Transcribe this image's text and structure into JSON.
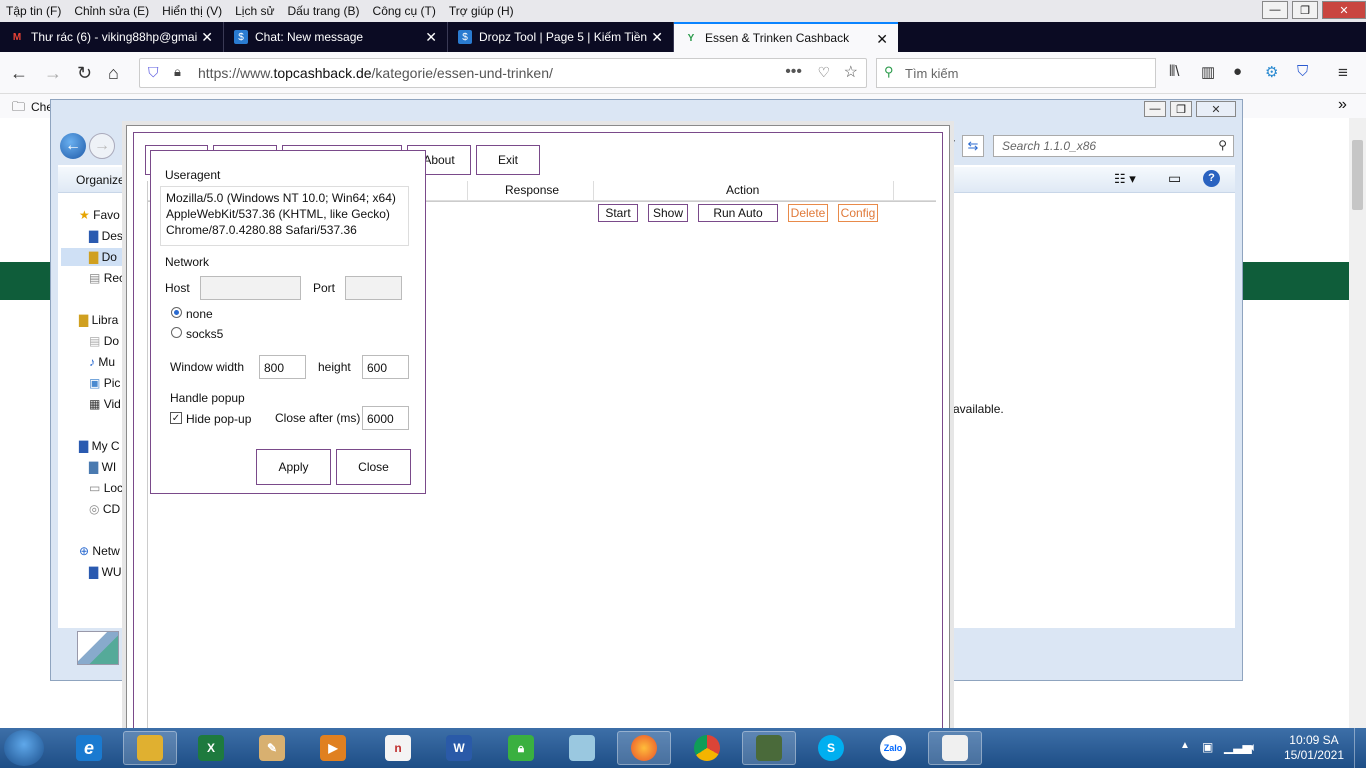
{
  "menubar": [
    "Tập tin (F)",
    "Chỉnh sửa (E)",
    "Hiển thị (V)",
    "Lịch sử",
    "Dấu trang (B)",
    "Công cụ (T)",
    "Trợ giúp (H)"
  ],
  "tabs": [
    {
      "label": "Thư rác (6) - viking88hp@gmai",
      "icon": "gmail-icon"
    },
    {
      "label": "Chat: New message",
      "icon": "dollar-icon"
    },
    {
      "label": "Dropz Tool | Page 5 | Kiếm Tiền",
      "icon": "dollar-icon"
    },
    {
      "label": "Essen & Trinken Cashback",
      "icon": "topcashback-icon"
    }
  ],
  "url": {
    "prefix": "https://www.",
    "domain": "topcashback.de",
    "path": "/kategorie/essen-und-trinken/"
  },
  "search_placeholder": "Tìm kiếm",
  "bookmarks_first": "Che",
  "explorer": {
    "toolbar_label": "Organize",
    "search_placeholder": "Search 1.1.0_x86",
    "nav_items": [
      "Favo",
      "Des",
      "Do",
      "Rec",
      "Libra",
      "Do",
      "Mu",
      "Pic",
      "Vid",
      "My C",
      "WI",
      "Loc",
      "CD",
      "Netw",
      "WU"
    ],
    "status_text": "available."
  },
  "app": {
    "buttons": {
      "about": "About",
      "exit": "Exit"
    },
    "columns": {
      "response": "Response",
      "action": "Action"
    },
    "row_actions": {
      "start": "Start",
      "show": "Show",
      "run_auto": "Run Auto",
      "delete": "Delete",
      "config": "Config"
    }
  },
  "dialog": {
    "useragent_label": "Useragent",
    "useragent_lines": [
      "Mozilla/5.0 (Windows NT 10.0; Win64; x64)",
      "AppleWebKit/537.36 (KHTML, like Gecko)",
      "Chrome/87.0.4280.88 Safari/537.36"
    ],
    "network_label": "Network",
    "host_label": "Host",
    "port_label": "Port",
    "host_value": "",
    "port_value": "",
    "proxy_options": [
      "none",
      "socks5"
    ],
    "proxy_selected": "none",
    "window_width_label": "Window width",
    "window_width_value": "800",
    "height_label": "height",
    "height_value": "600",
    "popup_label": "Handle popup",
    "hide_popup_label": "Hide pop-up",
    "hide_popup_checked": true,
    "close_after_label": "Close after (ms)",
    "close_after_value": "6000",
    "apply_label": "Apply",
    "close_label": "Close"
  },
  "taskbar": {
    "apps": [
      "internet-explorer",
      "file-explorer",
      "excel",
      "paint",
      "media-player",
      "app-dn",
      "word",
      "vpn-lock",
      "notepad",
      "firefox",
      "chrome",
      "monitor",
      "skype",
      "zalo",
      "app-window"
    ],
    "zalo_label": "Zalo",
    "time": "10:09 SA",
    "date": "15/01/2021"
  }
}
